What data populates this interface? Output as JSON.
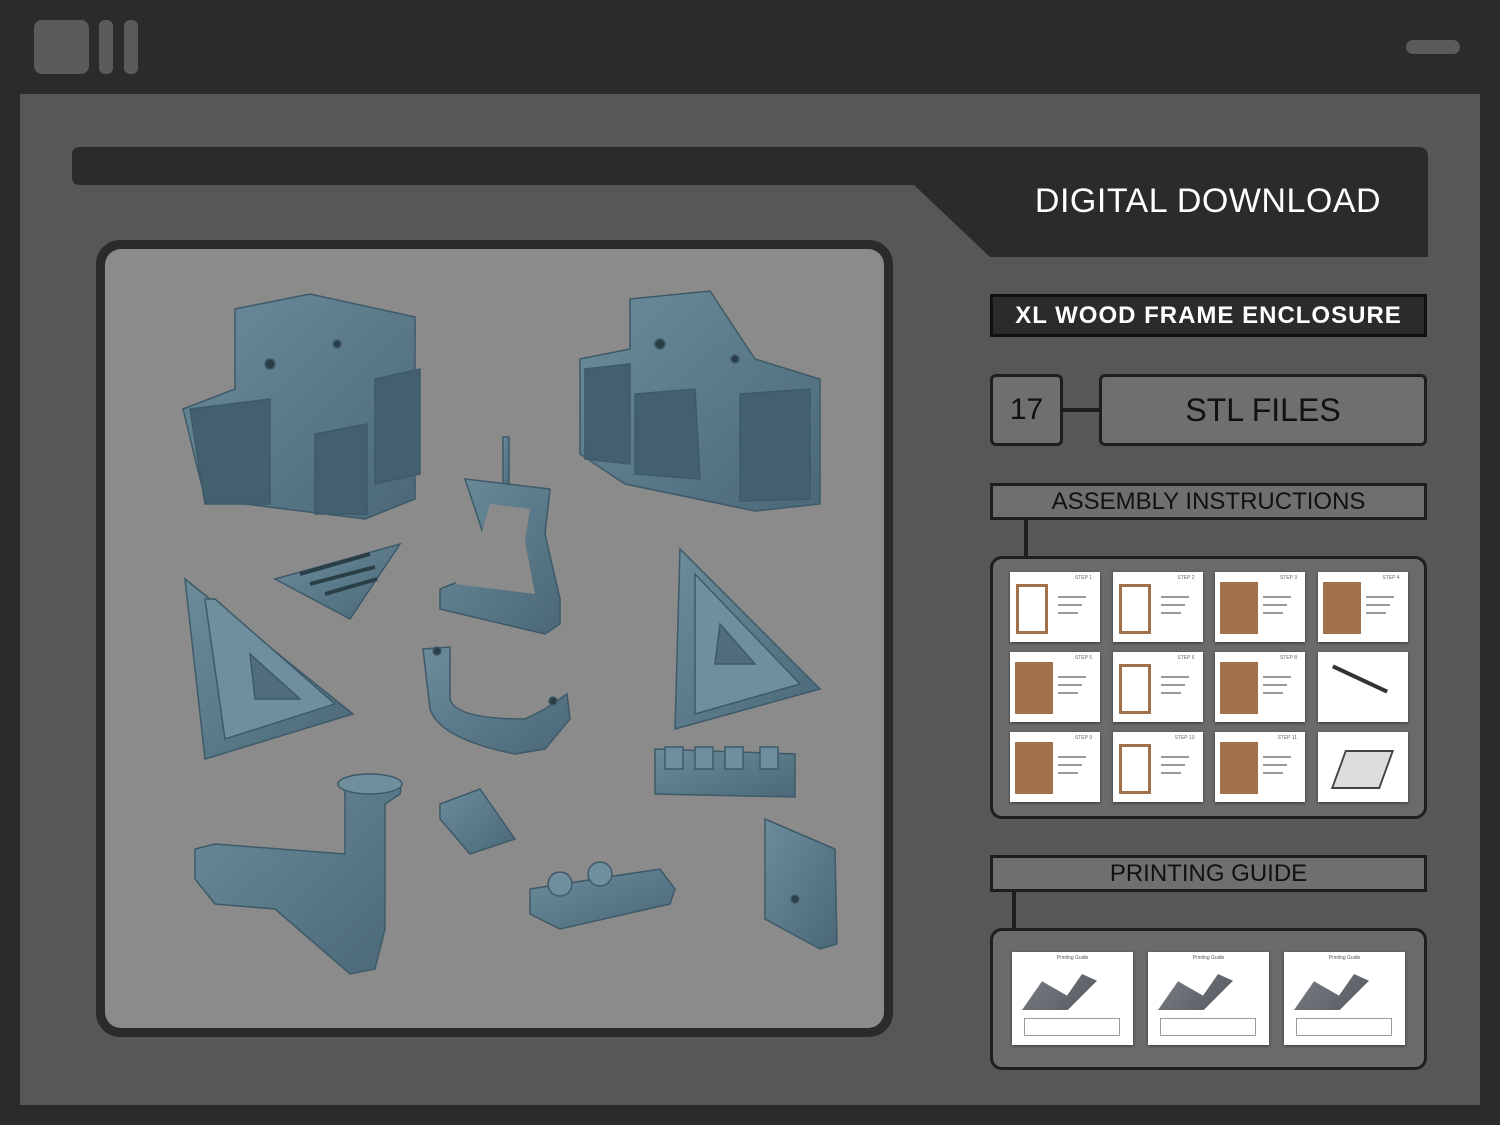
{
  "header": {
    "title": "DIGITAL DOWNLOAD"
  },
  "product": {
    "name": "XL WOOD FRAME ENCLOSURE"
  },
  "stl": {
    "count": "17",
    "label": "STL FILES"
  },
  "assembly": {
    "label": "ASSEMBLY INSTRUCTIONS",
    "pages": [
      {
        "title": "STEP 1",
        "kind": "frame"
      },
      {
        "title": "STEP 2",
        "kind": "frame"
      },
      {
        "title": "STEP 3",
        "kind": "wood"
      },
      {
        "title": "STEP 4",
        "kind": "wood"
      },
      {
        "title": "STEP 5",
        "kind": "wood"
      },
      {
        "title": "STEP 6",
        "kind": "frame"
      },
      {
        "title": "STEP 8",
        "kind": "wood"
      },
      {
        "title": "",
        "kind": "rods"
      },
      {
        "title": "STEP 9",
        "kind": "wood"
      },
      {
        "title": "STEP 10",
        "kind": "frame"
      },
      {
        "title": "STEP 11",
        "kind": "wood"
      },
      {
        "title": "",
        "kind": "tray"
      }
    ]
  },
  "printing": {
    "label": "PRINTING GUIDE",
    "pages": [
      {
        "title": "Printing Guide"
      },
      {
        "title": "Printing Guide"
      },
      {
        "title": "Printing Guide"
      }
    ]
  },
  "colors": {
    "background": "#2b2b2b",
    "panel": "#575757",
    "label_box": "#6f6f6f",
    "part": "#5a7a89",
    "render_bg": "#8b8b8b",
    "wood": "#a0714a"
  },
  "icons": {
    "window_controls": "app-logo-icon",
    "window_pill": "menu-pill-icon"
  }
}
